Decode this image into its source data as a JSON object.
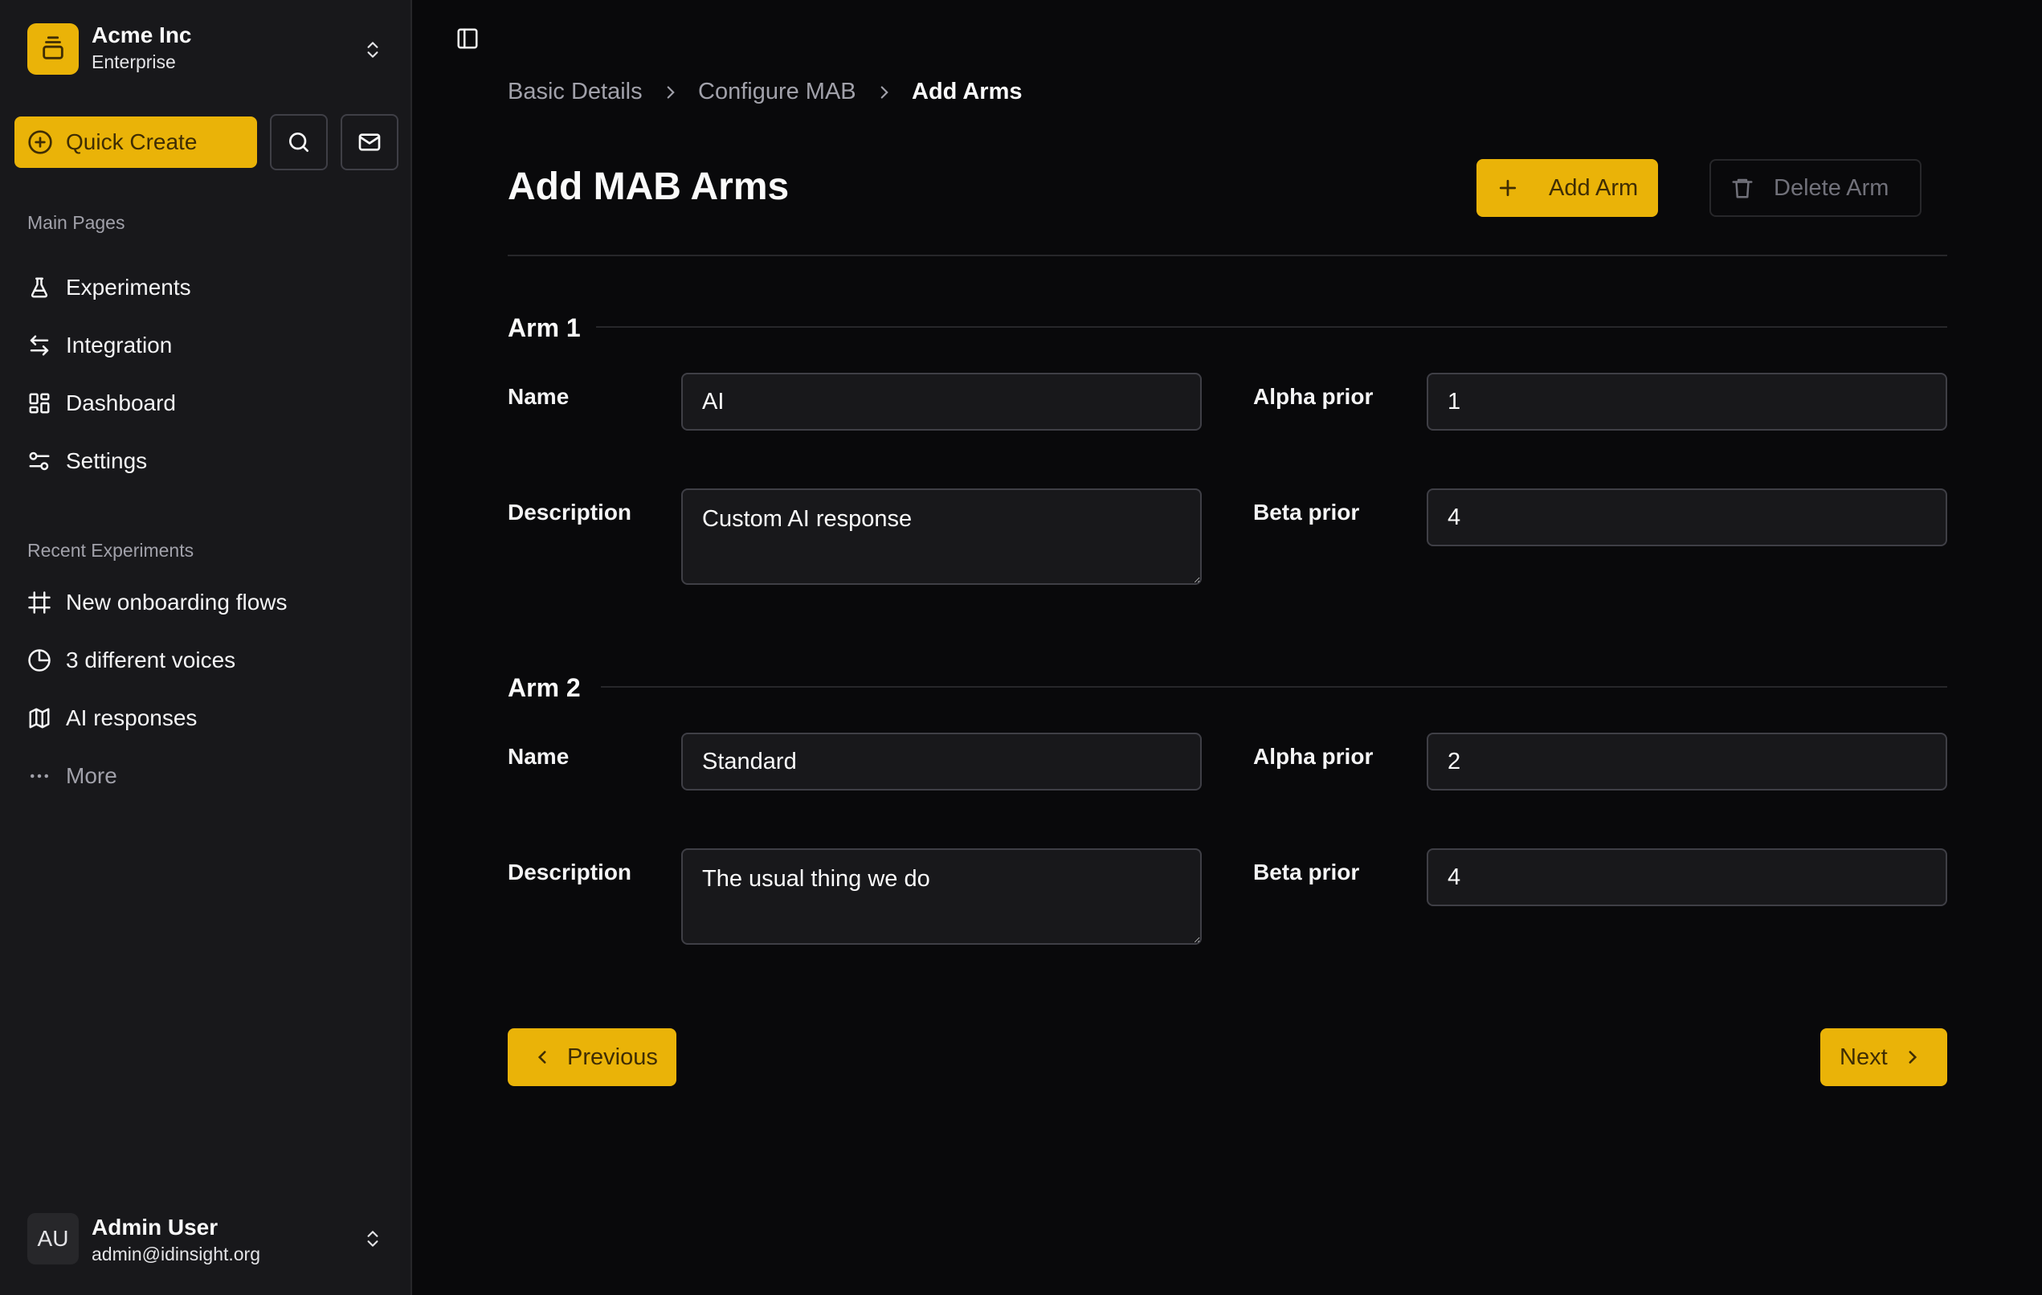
{
  "org": {
    "name": "Acme Inc",
    "plan": "Enterprise"
  },
  "quick_create": {
    "label": "Quick Create"
  },
  "sections": {
    "main_pages": "Main Pages",
    "recent_experiments": "Recent Experiments"
  },
  "main_nav": [
    {
      "label": "Experiments",
      "icon": "flask-icon"
    },
    {
      "label": "Integration",
      "icon": "arrows-left-right-icon"
    },
    {
      "label": "Dashboard",
      "icon": "dashboard-grid-icon"
    },
    {
      "label": "Settings",
      "icon": "sliders-icon"
    }
  ],
  "recent": [
    {
      "label": "New onboarding flows",
      "icon": "frame-icon"
    },
    {
      "label": "3 different voices",
      "icon": "pie-chart-icon"
    },
    {
      "label": "AI responses",
      "icon": "map-icon"
    },
    {
      "label": "More",
      "icon": "more-icon"
    }
  ],
  "user": {
    "initials": "AU",
    "name": "Admin User",
    "email": "admin@idinsight.org"
  },
  "breadcrumb": [
    "Basic Details",
    "Configure MAB",
    "Add Arms"
  ],
  "page": {
    "title": "Add MAB Arms",
    "add_arm": "Add Arm",
    "delete_arm": "Delete Arm"
  },
  "labels": {
    "name": "Name",
    "description": "Description",
    "alpha": "Alpha prior",
    "beta": "Beta prior"
  },
  "arms": [
    {
      "title": "Arm 1",
      "name": "AI",
      "description": "Custom AI response",
      "alpha": "1",
      "beta": "4"
    },
    {
      "title": "Arm 2",
      "name": "Standard",
      "description": "The usual thing we do",
      "alpha": "2",
      "beta": "4"
    }
  ],
  "footer": {
    "previous": "Previous",
    "next": "Next"
  },
  "colors": {
    "accent": "#eab308",
    "background": "#09090b",
    "sidebar": "#18181b"
  }
}
